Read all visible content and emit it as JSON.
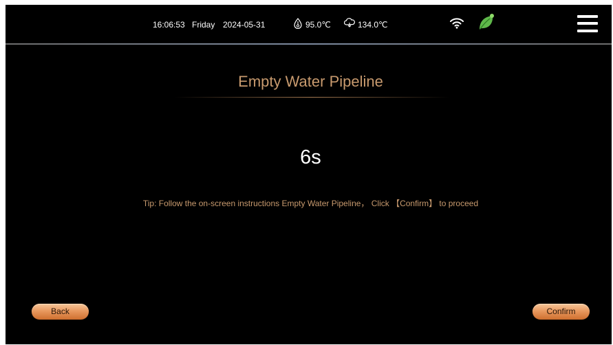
{
  "status_bar": {
    "time": "16:06:53",
    "day": "Friday",
    "date": "2024-05-31",
    "temp1_icon": "water-drop-temperature-icon",
    "temp1": "95.0℃",
    "temp2_icon": "steam-temperature-icon",
    "temp2": "134.0℃",
    "wifi_icon": "wifi-icon",
    "eco_icon": "leaf-icon",
    "menu_icon": "hamburger-menu-icon"
  },
  "main": {
    "title": "Empty Water Pipeline",
    "countdown": "6s",
    "tip": "Tip: Follow the on-screen instructions Empty Water Pipeline， Click 【Confirm】 to proceed"
  },
  "buttons": {
    "back_label": "Back",
    "confirm_label": "Confirm"
  },
  "colors": {
    "background": "#000000",
    "accent_text": "#c89a6e",
    "button_gradient_top": "#f6c79b",
    "button_gradient_bottom": "#cf6f2f",
    "leaf_green": "#5fb84a"
  }
}
